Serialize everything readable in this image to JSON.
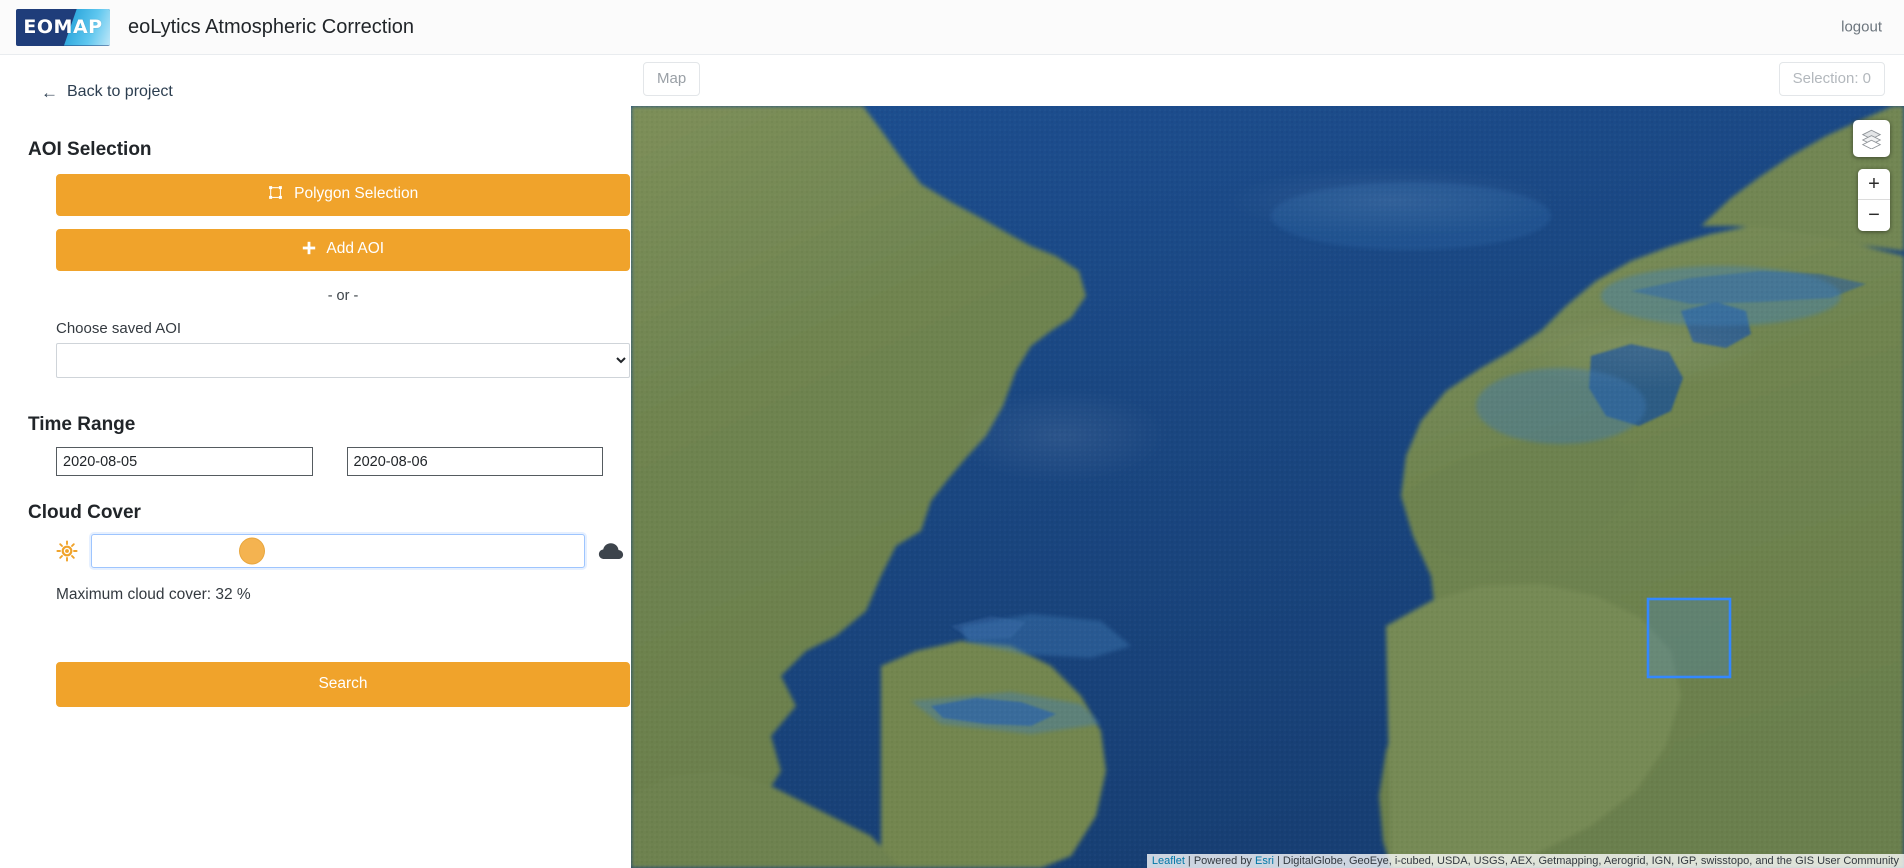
{
  "header": {
    "logo_text": "EOMAP",
    "logo_name": "eomap-logo",
    "app_title": "eoLytics Atmospheric Correction",
    "logout_label": "logout",
    "brand_navy": "#1f3d7a",
    "brand_cyan": "#5fc7ef"
  },
  "sidebar": {
    "back_link": {
      "label": "Back to project",
      "arrow": "←"
    },
    "aoi": {
      "section_title": "AOI Selection",
      "polygon_button_label": "Polygon Selection",
      "polygon_icon": "vector-square-icon",
      "add_aoi_button_label": "Add AOI",
      "add_icon": "plus-icon",
      "or_text": "- or -",
      "saved_aoi_label": "Choose saved AOI",
      "saved_aoi_value": "",
      "saved_aoi_options": [
        ""
      ]
    },
    "time_range": {
      "section_title": "Time Range",
      "start_date": "2020-08-05",
      "end_date": "2020-08-06",
      "start_placeholder": "",
      "end_placeholder": ""
    },
    "cloud_cover": {
      "section_title": "Cloud Cover",
      "sun_icon": "sun-icon",
      "cloud_icon": "cloud-icon",
      "slider_value": 32,
      "slider_min": 0,
      "slider_max": 100,
      "readout": "Maximum cloud cover: 32 %"
    },
    "search_button_label": "Search",
    "accent_color": "#f0a32b"
  },
  "map": {
    "tab_label": "Map",
    "selection_badge": "Selection: 0",
    "layers_icon": "layers-icon",
    "zoom_in_label": "+",
    "zoom_out_label": "−",
    "aoi_rectangle": {
      "stroke": "#3388ff",
      "fill": "#3388ff"
    },
    "attribution": {
      "leaflet": "Leaflet",
      "sep1": " | Powered by ",
      "esri": "Esri",
      "rest": " | DigitalGlobe, GeoEye, i-cubed, USDA, USGS, AEX, Getmapping, Aerogrid, IGN, IGP, swisstopo, and the GIS User Community"
    }
  }
}
